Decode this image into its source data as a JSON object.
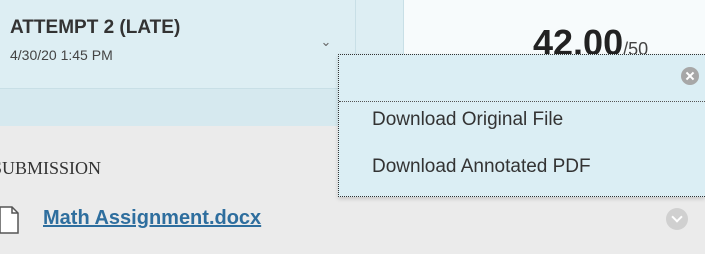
{
  "attempt": {
    "title": "ATTEMPT 2 (LATE)",
    "date": "4/30/20 1:45 PM",
    "chevron_icon": "chevron-down-icon"
  },
  "score": {
    "value": "42.00",
    "total": "/50"
  },
  "dropdown": {
    "close_icon": "close-icon",
    "items": [
      {
        "label": "Download Original File"
      },
      {
        "label": "Download Annotated PDF"
      }
    ]
  },
  "submission": {
    "label": "SUBMISSION",
    "file_name": "Math Assignment.docx",
    "file_icon": "document-icon",
    "options_icon": "chevron-down-circle-icon"
  },
  "colors": {
    "panel_bg": "#ddeef3",
    "dropdown_bg": "#dbeef4",
    "link": "#2e6e9e",
    "page_bg": "#ebebeb"
  }
}
